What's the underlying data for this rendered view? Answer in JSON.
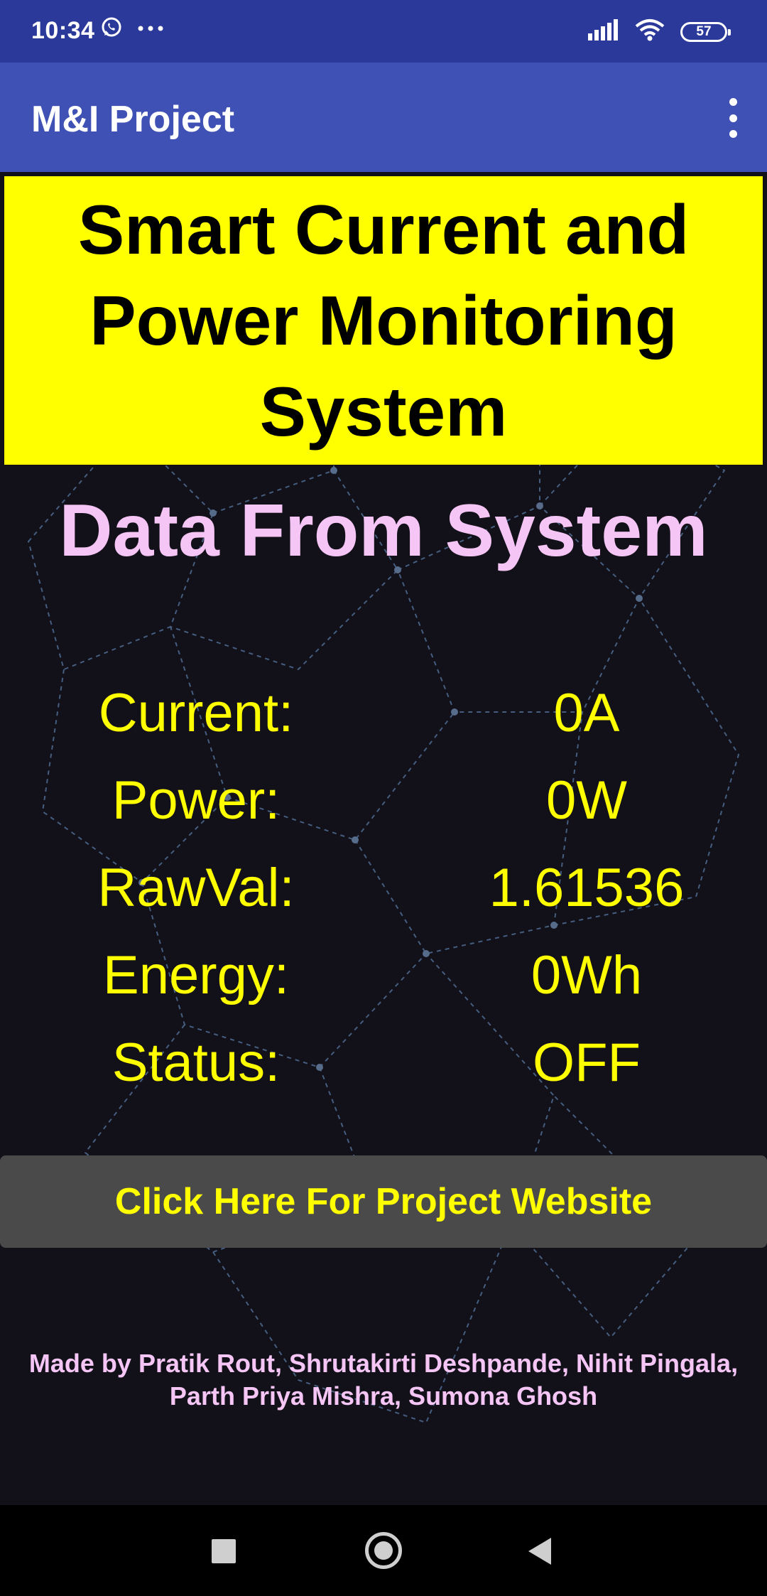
{
  "status_bar": {
    "time": "10:34",
    "icons": [
      "whatsapp-icon",
      "more-dots-icon",
      "signal-icon",
      "wifi-icon",
      "battery-icon"
    ],
    "battery_level": "57"
  },
  "app_bar": {
    "title": "M&I Project",
    "menu_icon": "overflow-menu-icon"
  },
  "banner": {
    "title": "Smart Current and Power Monitoring System"
  },
  "data_section": {
    "heading": "Data From System",
    "readings": [
      {
        "label": "Current:",
        "value": "0A"
      },
      {
        "label": "Power:",
        "value": "0W"
      },
      {
        "label": "RawVal:",
        "value": "1.61536"
      },
      {
        "label": "Energy:",
        "value": "0Wh"
      },
      {
        "label": "Status:",
        "value": "OFF"
      }
    ]
  },
  "website_button": {
    "label": "Click Here For Project Website"
  },
  "credits": {
    "text": "Made by Pratik Rout, Shrutakirti Deshpande, Nihit Pingala, Parth Priya Mishra, Sumona Ghosh"
  },
  "nav_bar": {
    "icons": [
      "recents-icon",
      "home-icon",
      "back-icon"
    ]
  },
  "colors": {
    "status_bar": "#2b3a9a",
    "app_bar": "#3f51b5",
    "banner": "#ffff00",
    "heading": "#f5c6f5",
    "reading_text": "#ffff00",
    "button_bg": "#4a4a4a",
    "background": "#121018"
  }
}
